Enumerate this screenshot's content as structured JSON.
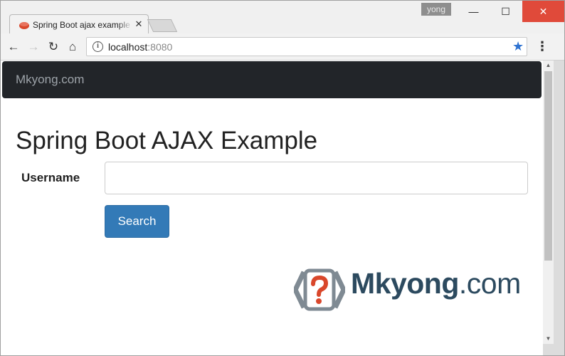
{
  "browser": {
    "tab_title": "Spring Boot ajax example",
    "tab_close": "✕",
    "user_label": "yong",
    "window_controls": {
      "minimize": "—",
      "maximize": "☐",
      "close": "✕"
    },
    "url_host": "localhost",
    "url_port": ":8080",
    "nav": {
      "back": "←",
      "forward": "→",
      "reload": "↻",
      "home": "⌂"
    },
    "bookmark_icon": "★",
    "menu_icon": "⋮",
    "info_icon": "i",
    "accent_color": "#2f73d1"
  },
  "page": {
    "brand": "Mkyong.com",
    "title": "Spring Boot AJAX Example",
    "form": {
      "username_label": "Username",
      "username_value": "",
      "search_label": "Search"
    },
    "logo": {
      "name": "Mkyong",
      "suffix": ".com"
    },
    "colors": {
      "navbar": "#222529",
      "button": "#337ab7",
      "logo_text": "#2c4a5f",
      "logo_mark": "#d9472b"
    }
  },
  "scrollbar": {
    "up": "▲",
    "down": "▼"
  }
}
